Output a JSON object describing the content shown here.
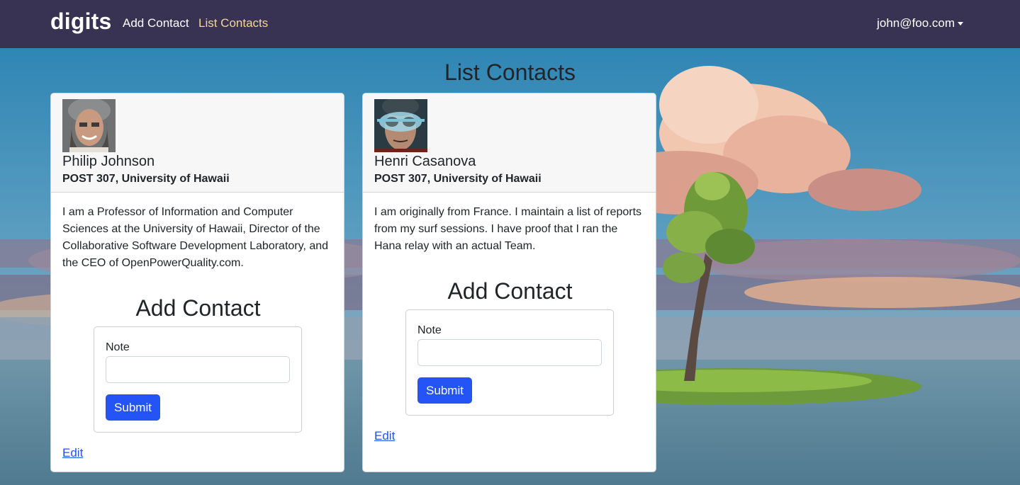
{
  "navbar": {
    "brand": "digits",
    "links": [
      "Add Contact",
      "List Contacts"
    ],
    "user": "john@foo.com"
  },
  "page": {
    "title": "List Contacts"
  },
  "contacts": [
    {
      "name": "Philip Johnson",
      "address": "POST 307, University of Hawaii",
      "description": "I am a Professor of Information and Computer Sciences at the University of Hawaii, Director of the Collaborative Software Development Laboratory, and the CEO of OpenPowerQuality.com.",
      "form_title": "Add Contact",
      "note_label": "Note",
      "note_value": "",
      "submit_label": "Submit",
      "edit_label": "Edit"
    },
    {
      "name": "Henri Casanova",
      "address": "POST 307, University of Hawaii",
      "description": "I am originally from France. I maintain a list of reports from my surf sessions. I have proof that I ran the Hana relay with an actual Team.",
      "form_title": "Add Contact",
      "note_label": "Note",
      "note_value": "",
      "submit_label": "Submit",
      "edit_label": "Edit"
    }
  ],
  "colors": {
    "navbar": "#383353",
    "active_link": "#f5d59a",
    "submit": "#2454f5",
    "link": "#2155e0"
  }
}
